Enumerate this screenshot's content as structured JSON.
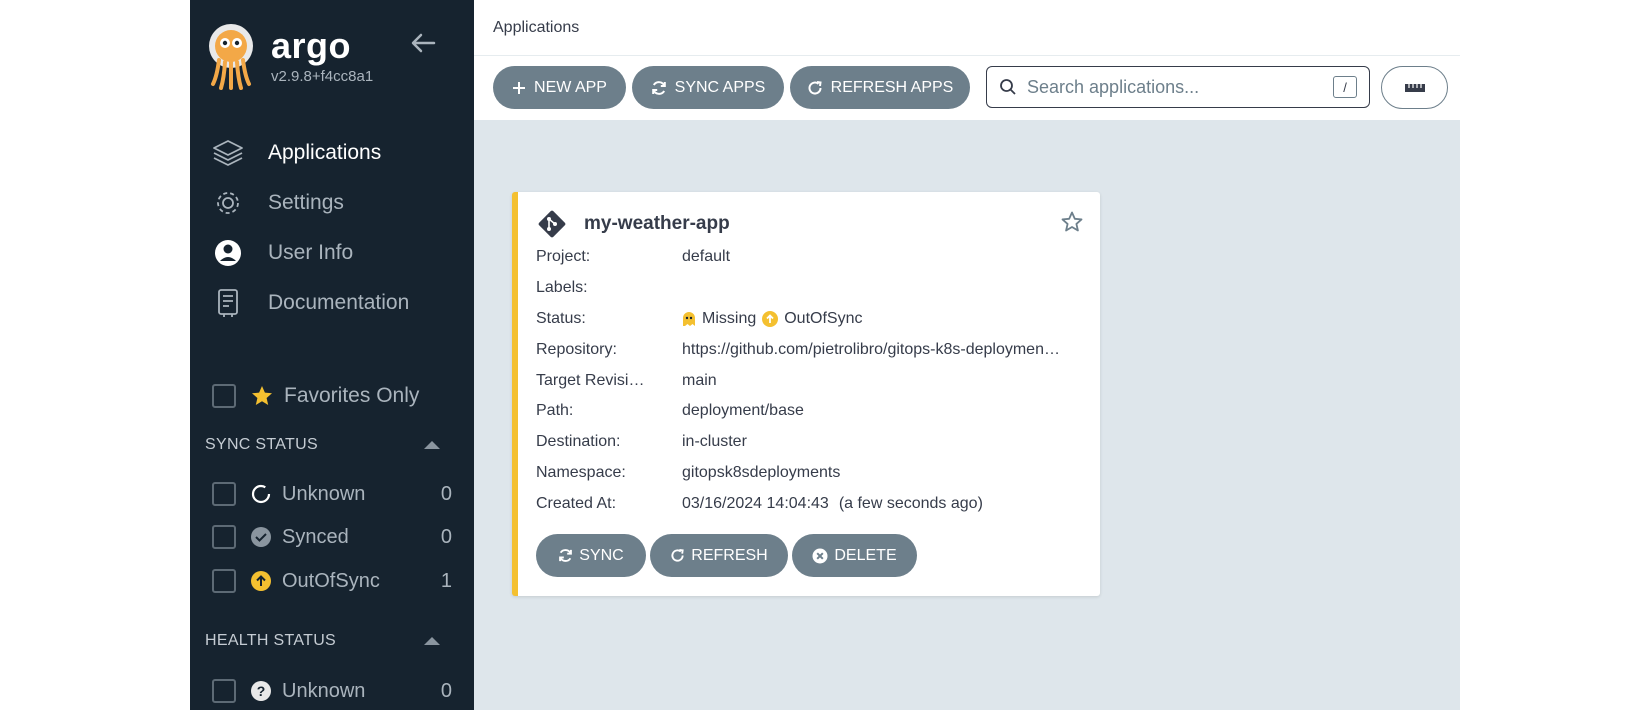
{
  "brand": {
    "name": "argo",
    "version": "v2.9.8+f4cc8a1"
  },
  "nav": {
    "items": [
      {
        "label": "Applications",
        "icon": "layers-icon",
        "active": true
      },
      {
        "label": "Settings",
        "icon": "gear-icon"
      },
      {
        "label": "User Info",
        "icon": "user-circle-icon"
      },
      {
        "label": "Documentation",
        "icon": "docs-icon"
      }
    ]
  },
  "filters": {
    "favorites_label": "Favorites Only",
    "sync_status": {
      "title": "SYNC STATUS",
      "items": [
        {
          "label": "Unknown",
          "count": "0"
        },
        {
          "label": "Synced",
          "count": "0"
        },
        {
          "label": "OutOfSync",
          "count": "1"
        }
      ]
    },
    "health_status": {
      "title": "HEALTH STATUS",
      "items": [
        {
          "label": "Unknown",
          "count": "0"
        }
      ]
    }
  },
  "header": {
    "title": "Applications"
  },
  "toolbar": {
    "new_app": "NEW APP",
    "sync_apps": "SYNC APPS",
    "refresh_apps": "REFRESH APPS",
    "search_placeholder": "Search applications...",
    "search_shortcut": "/"
  },
  "app_card": {
    "name": "my-weather-app",
    "fields": {
      "project": {
        "label": "Project:",
        "value": "default"
      },
      "labels": {
        "label": "Labels:",
        "value": ""
      },
      "status": {
        "label": "Status:",
        "health": "Missing",
        "sync": "OutOfSync"
      },
      "repository": {
        "label": "Repository:",
        "value": "https://github.com/pietrolibro/gitops-k8s-deploymen…"
      },
      "target_revision": {
        "label": "Target Revisi…",
        "value": "main"
      },
      "path": {
        "label": "Path:",
        "value": "deployment/base"
      },
      "destination": {
        "label": "Destination:",
        "value": "in-cluster"
      },
      "namespace": {
        "label": "Namespace:",
        "value": "gitopsk8sdeployments"
      },
      "created_at": {
        "label": "Created At:",
        "value": "03/16/2024 14:04:43",
        "relative": "(a few seconds ago)"
      }
    },
    "actions": {
      "sync": "SYNC",
      "refresh": "REFRESH",
      "delete": "DELETE"
    }
  },
  "colors": {
    "sidebar_bg": "#16232f",
    "main_bg": "#dee6eb",
    "button_bg": "#6d7f8b",
    "accent_yellow": "#f4c030",
    "out_of_sync": "#f4c030"
  }
}
